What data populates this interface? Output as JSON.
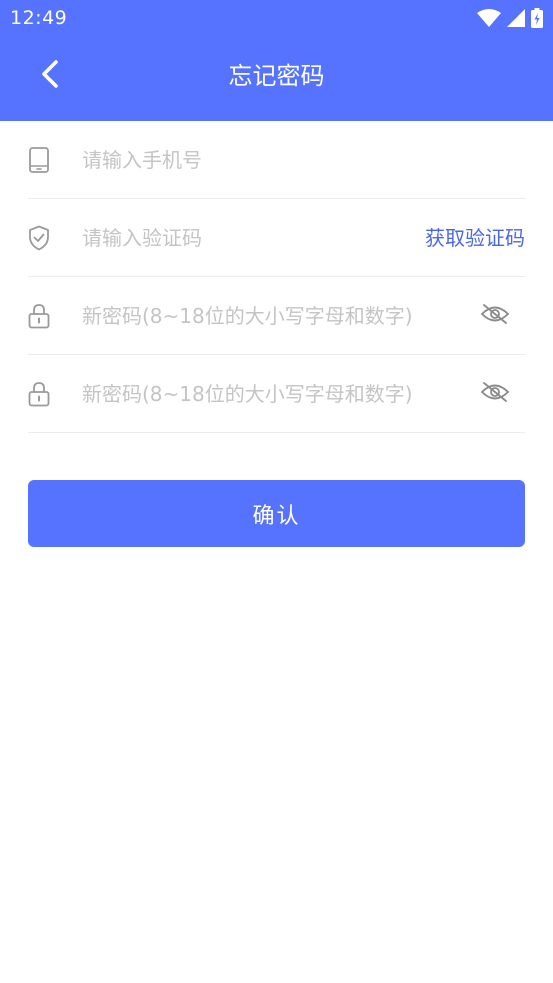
{
  "status_bar": {
    "time": "12:49",
    "icons": [
      "wifi-icon",
      "cell-signal-icon",
      "battery-charging-icon"
    ]
  },
  "header": {
    "title": "忘记密码",
    "back_icon": "chevron-left-icon",
    "background_color": "#5573FF"
  },
  "form": {
    "phone": {
      "placeholder": "请输入手机号",
      "value": "",
      "icon": "phone-icon"
    },
    "code": {
      "placeholder": "请输入验证码",
      "value": "",
      "icon": "shield-check-icon",
      "action_label": "获取验证码"
    },
    "new_password": {
      "placeholder": "新密码(8~18位的大小写字母和数字)",
      "value": "",
      "icon": "lock-icon",
      "toggle_icon": "eye-off-icon"
    },
    "confirm_password": {
      "placeholder": "新密码(8~18位的大小写字母和数字)",
      "value": "",
      "icon": "lock-icon",
      "toggle_icon": "eye-off-icon"
    }
  },
  "confirm_button": {
    "label": "确认",
    "color": "#5573FF"
  },
  "colors": {
    "accent": "#5573FF",
    "link": "#4A67E8",
    "placeholder": "#c4c4c4",
    "divider": "#ececec"
  }
}
